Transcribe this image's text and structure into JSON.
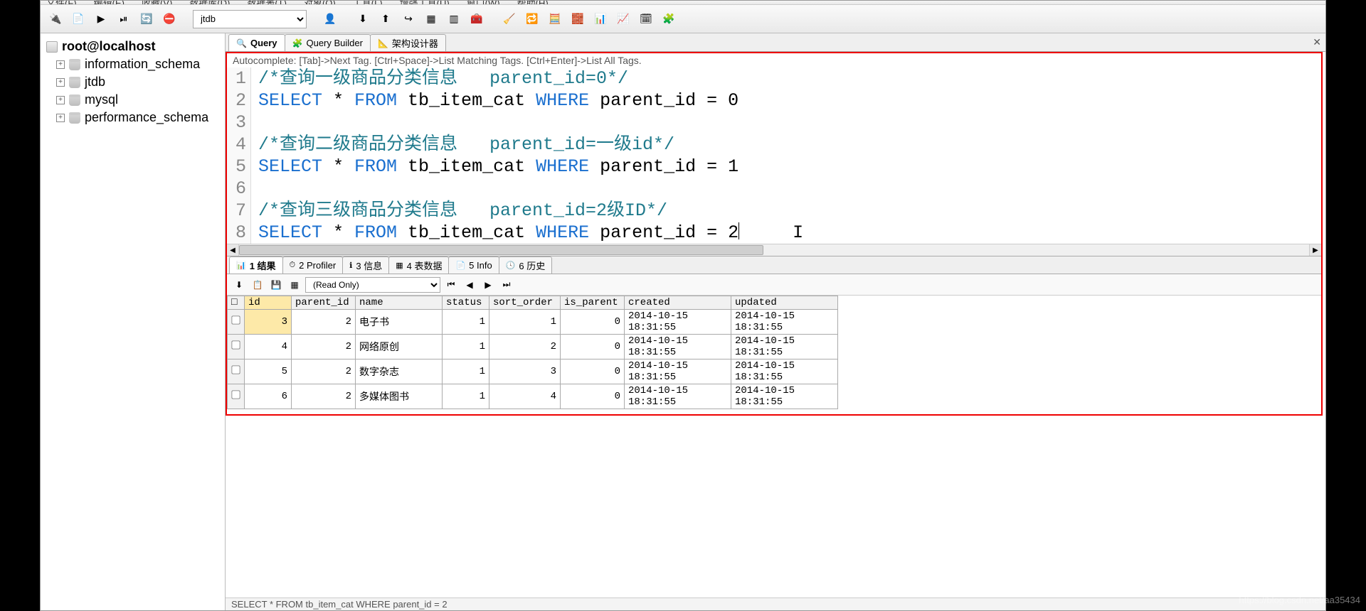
{
  "menu": [
    "文件(F)",
    "编辑(E)",
    "收藏(V)",
    "数据库(D)",
    "数据表(T)",
    "对象(O)",
    "工具(L)",
    "增强工具(U)",
    "窗口(W)",
    "帮助(H)"
  ],
  "toolbar": {
    "db_selected": "jtdb",
    "icons": [
      "connect-icon",
      "new-conn-icon",
      "execute-icon",
      "execute-all-icon",
      "refresh-icon",
      "stop-icon",
      "user-icon",
      "export-icon",
      "import-icon",
      "backup-icon",
      "table-icon",
      "table2-icon",
      "tool-icon",
      "refresh2-icon",
      "sync-icon",
      "diff-icon",
      "trans-icon",
      "chart-icon",
      "chart2-icon",
      "grid-icon",
      "help-icon"
    ]
  },
  "sidebar": {
    "root": "root@localhost",
    "items": [
      "information_schema",
      "jtdb",
      "mysql",
      "performance_schema"
    ]
  },
  "editor_tabs": [
    {
      "icon": "🔍",
      "label": "Query",
      "active": true
    },
    {
      "icon": "🧩",
      "label": "Query Builder",
      "active": false
    },
    {
      "icon": "📐",
      "label": "架构设计器",
      "active": false
    }
  ],
  "hint": "Autocomplete: [Tab]->Next Tag. [Ctrl+Space]->List Matching Tags. [Ctrl+Enter]->List All Tags.",
  "sql": {
    "lines": [
      {
        "n": 1,
        "tokens": [
          {
            "t": "/*查询一级商品分类信息   parent_id=0*/",
            "c": "cm"
          }
        ]
      },
      {
        "n": 2,
        "tokens": [
          {
            "t": "SELECT",
            "c": "kw"
          },
          {
            "t": " * "
          },
          {
            "t": "FROM",
            "c": "kw"
          },
          {
            "t": " tb_item_cat "
          },
          {
            "t": "WHERE",
            "c": "kw"
          },
          {
            "t": " parent_id = 0"
          }
        ]
      },
      {
        "n": 3,
        "tokens": []
      },
      {
        "n": 4,
        "tokens": [
          {
            "t": "/*查询二级商品分类信息   parent_id=一级id*/",
            "c": "cm"
          }
        ]
      },
      {
        "n": 5,
        "tokens": [
          {
            "t": "SELECT",
            "c": "kw"
          },
          {
            "t": " * "
          },
          {
            "t": "FROM",
            "c": "kw"
          },
          {
            "t": " tb_item_cat "
          },
          {
            "t": "WHERE",
            "c": "kw"
          },
          {
            "t": " parent_id = 1"
          }
        ]
      },
      {
        "n": 6,
        "tokens": []
      },
      {
        "n": 7,
        "tokens": [
          {
            "t": "/*查询三级商品分类信息   parent_id=2级ID*/",
            "c": "cm"
          }
        ]
      },
      {
        "n": 8,
        "tokens": [
          {
            "t": "SELECT",
            "c": "kw"
          },
          {
            "t": " * "
          },
          {
            "t": "FROM",
            "c": "kw"
          },
          {
            "t": " tb_item_cat "
          },
          {
            "t": "WHERE",
            "c": "kw"
          },
          {
            "t": " parent_id = 2"
          }
        ],
        "cursor": true
      }
    ]
  },
  "result_tabs": [
    {
      "ico": "📊",
      "label": "1 结果",
      "active": true
    },
    {
      "ico": "⏱",
      "label": "2 Profiler"
    },
    {
      "ico": "ℹ",
      "label": "3 信息"
    },
    {
      "ico": "▦",
      "label": "4 表数据"
    },
    {
      "ico": "📄",
      "label": "5 Info"
    },
    {
      "ico": "🕓",
      "label": "6 历史"
    }
  ],
  "result_toolbar": {
    "readonly": "(Read Only)"
  },
  "grid": {
    "cols": [
      "id",
      "parent_id",
      "name",
      "status",
      "sort_order",
      "is_parent",
      "created",
      "updated"
    ],
    "col_classes": [
      "col-id",
      "col-parent",
      "col-name",
      "col-status",
      "col-sort",
      "col-isp",
      "col-created",
      "col-updated"
    ],
    "num_cols": [
      0,
      1,
      3,
      4,
      5
    ],
    "selected_col": 0,
    "rows": [
      [
        "3",
        "2",
        "电子书",
        "1",
        "1",
        "0",
        "2014-10-15 18:31:55",
        "2014-10-15 18:31:55"
      ],
      [
        "4",
        "2",
        "网络原创",
        "1",
        "2",
        "0",
        "2014-10-15 18:31:55",
        "2014-10-15 18:31:55"
      ],
      [
        "5",
        "2",
        "数字杂志",
        "1",
        "3",
        "0",
        "2014-10-15 18:31:55",
        "2014-10-15 18:31:55"
      ],
      [
        "6",
        "2",
        "多媒体图书",
        "1",
        "4",
        "0",
        "2014-10-15 18:31:55",
        "2014-10-15 18:31:55"
      ]
    ]
  },
  "status": "SELECT * FROM tb_item_cat WHERE parent_id = 2",
  "watermark": "https://blog.csdn.net/aa35434"
}
